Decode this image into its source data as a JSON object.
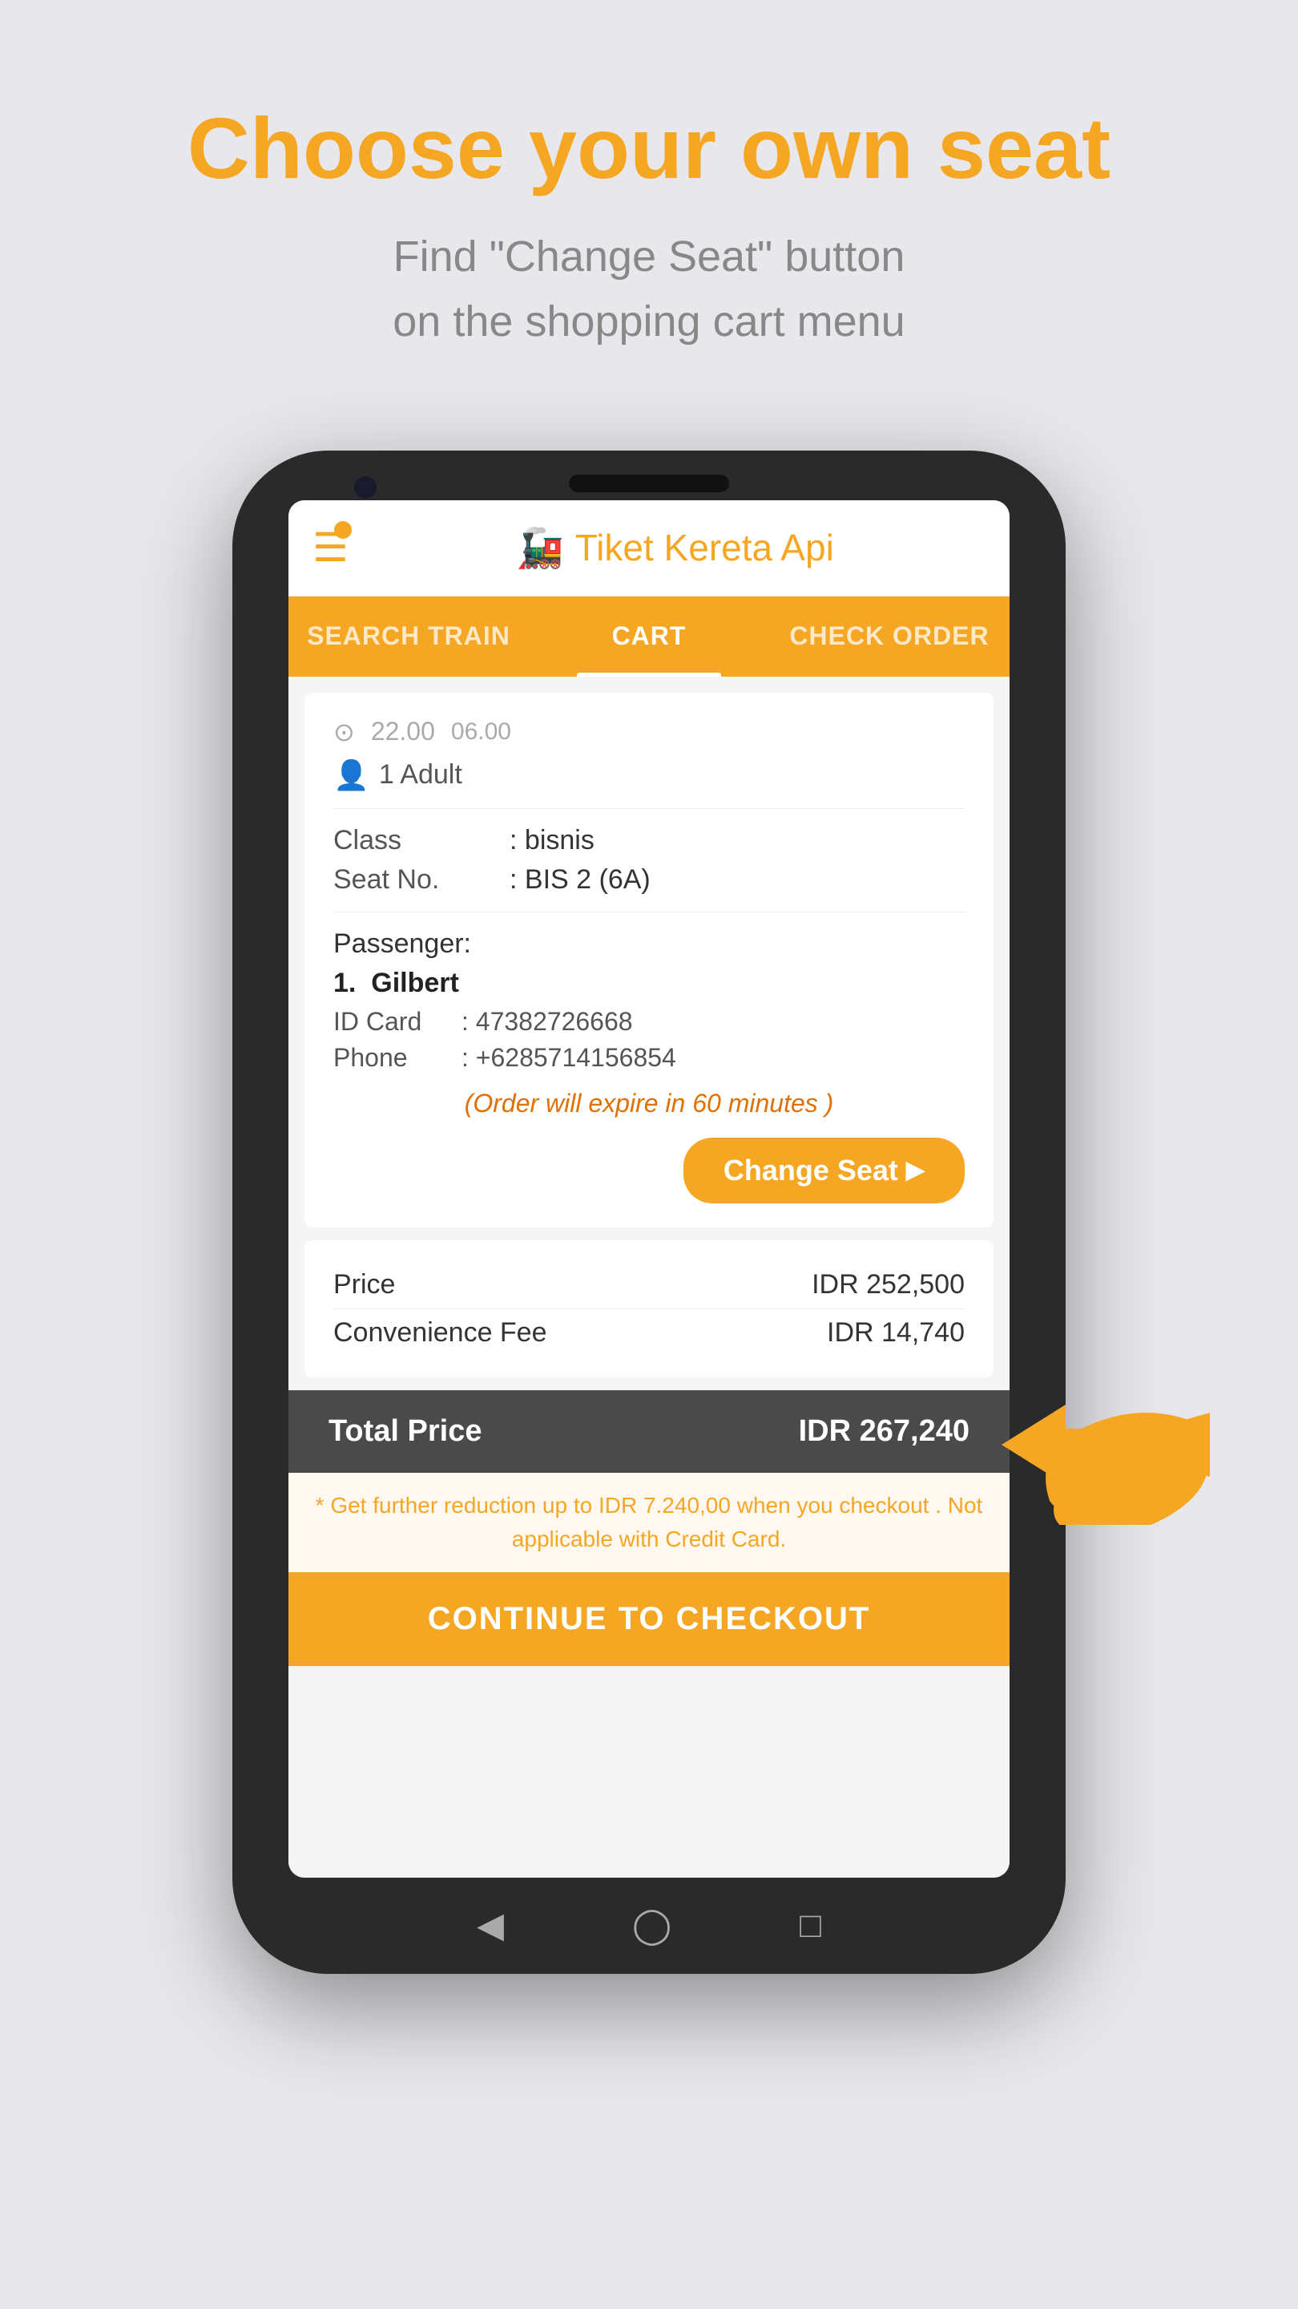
{
  "header": {
    "title": "Choose your own seat",
    "subtitle_line1": "Find \"Change Seat\" button",
    "subtitle_line2": "on the shopping cart menu"
  },
  "app": {
    "name": "Tiket Kereta Api",
    "logo_emoji": "🚂"
  },
  "tabs": [
    {
      "id": "search-train",
      "label": "SEARCH TRAIN",
      "active": false
    },
    {
      "id": "cart",
      "label": "CART",
      "active": true
    },
    {
      "id": "check-order",
      "label": "CHECK ORDER",
      "active": false
    }
  ],
  "order": {
    "time_depart": "22.00",
    "time_arrive": "06.00",
    "passengers": "1 Adult",
    "class_label": "Class",
    "class_value": "bisnis",
    "seat_label": "Seat No.",
    "seat_value": "BIS 2 (6A)",
    "passenger_header": "Passenger:",
    "passenger_number": "1.",
    "passenger_name": "Gilbert",
    "id_card_label": "ID Card",
    "id_card_value": "47382726668",
    "phone_label": "Phone",
    "phone_value": "+6285714156854",
    "expire_notice": "(Order will expire in 60 minutes )",
    "change_seat_label": "Change Seat"
  },
  "pricing": {
    "price_label": "Price",
    "price_value": "IDR 252,500",
    "fee_label": "Convenience Fee",
    "fee_value": "IDR 14,740",
    "total_label": "Total Price",
    "total_value": "IDR 267,240",
    "reduction_notice": "* Get further reduction up to IDR 7.240,00 when you checkout . Not applicable with Credit Card.",
    "checkout_label": "CONTINUE TO CHECKOUT"
  }
}
